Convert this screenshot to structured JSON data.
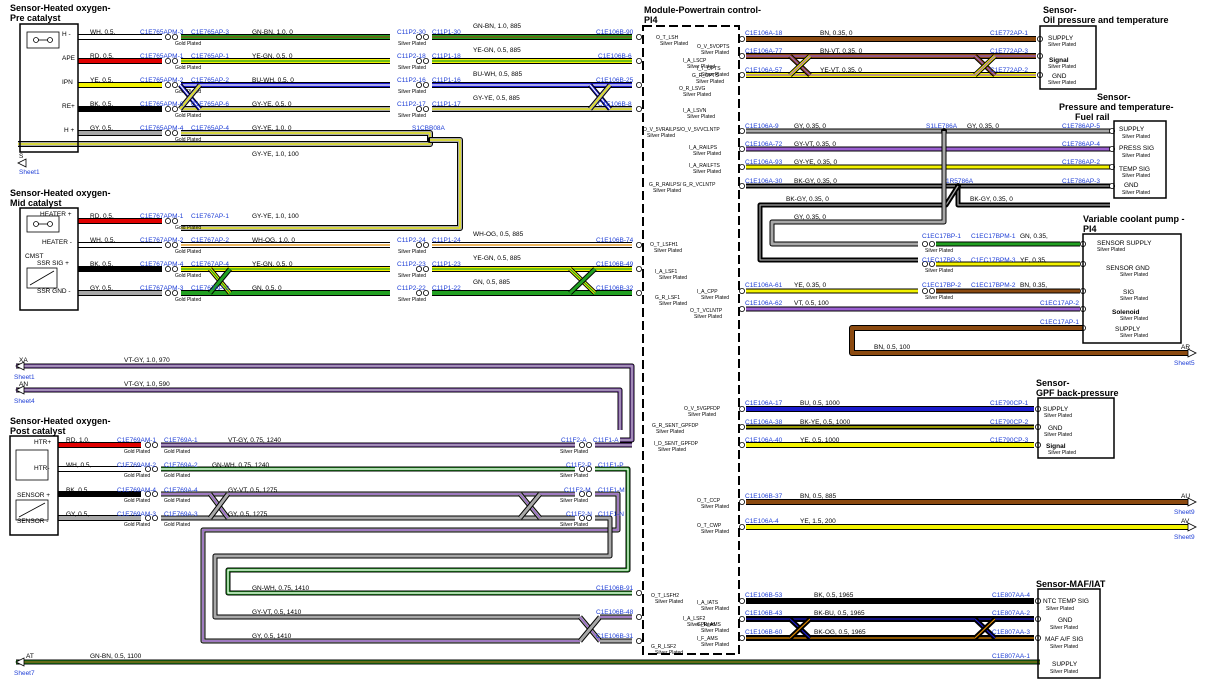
{
  "components": {
    "ho2_pre": {
      "title1": "Sensor-Heated oxygen-",
      "title2": "Pre catalyst",
      "pins": [
        "H -",
        "APE",
        "IPN",
        "RE+",
        "H +"
      ]
    },
    "ho2_mid": {
      "title1": "Sensor-Heated oxygen-",
      "title2": "Mid catalyst",
      "pins": [
        "HEATER +",
        "HEATER -",
        "SSR SIG +",
        "SSR GND -"
      ],
      "cmst": "CMST"
    },
    "ho2_post": {
      "title1": "Sensor-Heated oxygen-",
      "title2": "Post catalyst",
      "pins": [
        "HTR+",
        "HTR-",
        "SENSOR +",
        "SENSOR -"
      ]
    },
    "pcm": {
      "title1": "Module-Powertrain control-",
      "title2": "PI4",
      "signals": [
        "O_T_LSH",
        "O_V_5VOPTS",
        "I_A_LSCP",
        "I_T_OPTS",
        "G_R_OPTS",
        "O_R_LSVG",
        "I_A_LSVN",
        "O_V_5VRAILPS/O_V_5VVCLNTP",
        "I_A_RAILPS",
        "I_A_RAILFTS",
        "G_R_RAILPS/ G_R_VCLNTP",
        "O_T_LSFH1",
        "I_A_LSF1",
        "I_A_CPP",
        "G_R_LSF1",
        "O_T_VCLNTP",
        "O_V_5VGPFDP",
        "G_R_SENT_GPFDP",
        "I_D_SENT_GPFDP",
        "O_T_CCP",
        "O_T_CWP",
        "O_T_LSFH2",
        "I_A_IATS",
        "I_A_LSF2",
        "G_R_AMS",
        "I_F_AMS",
        "G_R_LSF2"
      ]
    },
    "oil": {
      "title1": "Sensor-",
      "title2": "Oil pressure and temperature",
      "pins": [
        "SUPPLY",
        "Signal",
        "GND"
      ]
    },
    "rail": {
      "title1": "Sensor-",
      "title2": "Pressure and temperature-",
      "title3": "Fuel rail",
      "pins": [
        "SUPPLY",
        "PRESS SIG",
        "TEMP SIG",
        "GND"
      ]
    },
    "coolant": {
      "title1": "Variable coolant pump -",
      "title2": "PI4",
      "pins": [
        "SENSOR SUPPLY",
        "SENSOR GND",
        "SIG",
        "Solenoid",
        "SUPPLY"
      ]
    },
    "gpf": {
      "title1": "Sensor-",
      "title2": "GPF back-pressure",
      "pins": [
        "SUPPLY",
        "GND",
        "Signal"
      ]
    },
    "maf": {
      "title1": "Sensor-MAF/IAT",
      "pins": [
        "NTC TEMP SIG",
        "GND",
        "MAF A/F SIG",
        "SUPPLY"
      ]
    }
  },
  "plating": {
    "gold": "Gold Plated",
    "silver": "Silver Plated"
  },
  "wires": [
    {
      "spec": "WH, 0.5,",
      "c1": "C1E765APM-3",
      "c2": "C1E765AP-3"
    },
    {
      "spec": "GN-BN, 1.0, 0",
      "c1": "C11P2-30",
      "c2": "C11P1-30"
    },
    {
      "spec": "GN-BN, 1.0, 885",
      "c1": "C1E106B-90",
      "c2": ""
    },
    {
      "spec": "RD, 0.5,",
      "c1": "C1E765APM-1",
      "c2": "C1E765AP-1"
    },
    {
      "spec": "YE-GN, 0.5, 0",
      "c1": "C11P2-18",
      "c2": "C11P1-18"
    },
    {
      "spec": "YE-GN, 0.5, 885",
      "c1": "C1E106B-6",
      "c2": ""
    },
    {
      "spec": "YE, 0.5,",
      "c1": "C1E765APM-2",
      "c2": "C1E765AP-2"
    },
    {
      "spec": "BU-WH, 0.5, 0",
      "c1": "C11P2-16",
      "c2": "C11P1-16"
    },
    {
      "spec": "BU-WH, 0.5, 885",
      "c1": "C1E106B-25",
      "c2": ""
    },
    {
      "spec": "BK, 0.5,",
      "c1": "C1E765APM-6",
      "c2": "C1E765AP-6"
    },
    {
      "spec": "GY-YE, 0.5, 0",
      "c1": "C11P2-17",
      "c2": "C11P1-17"
    },
    {
      "spec": "GY-YE, 0.5, 885",
      "c1": "C1E106B-8",
      "c2": ""
    },
    {
      "spec": "GY, 0.5,",
      "c1": "C1E765APM-4",
      "c2": "C1E765AP-4"
    },
    {
      "spec": "GY-YE, 1.0, 0",
      "c1": "S1CBB08A",
      "c2": ""
    },
    {
      "spec": "GY-YE, 1.0, 100",
      "c1": "",
      "c2": ""
    },
    {
      "spec": "RD, 0.5,",
      "c1": "C1E767APM-1",
      "c2": "C1E767AP-1"
    },
    {
      "spec": "GY-YE, 1.0, 100",
      "c1": "",
      "c2": ""
    },
    {
      "spec": "WH, 0.5,",
      "c1": "C1E767APM-2",
      "c2": "C1E767AP-2"
    },
    {
      "spec": "WH-OG, 1.0, 0",
      "c1": "C11P2-24",
      "c2": "C11P1-24"
    },
    {
      "spec": "WH-OG, 0.5, 885",
      "c1": "C1E106B-74",
      "c2": ""
    },
    {
      "spec": "BK, 0.5,",
      "c1": "C1E767APM-4",
      "c2": "C1E767AP-4"
    },
    {
      "spec": "YE-GN, 0.5, 0",
      "c1": "C11P2-23",
      "c2": "C11P1-23"
    },
    {
      "spec": "YE-GN, 0.5, 885",
      "c1": "C1E106B-49",
      "c2": ""
    },
    {
      "spec": "GY, 0.5,",
      "c1": "C1E767APM-3",
      "c2": "C1E767AP-3"
    },
    {
      "spec": "GN, 0.5, 0",
      "c1": "C11P2-22",
      "c2": "C11P1-22"
    },
    {
      "spec": "GN, 0.5, 885",
      "c1": "C1E106B-32",
      "c2": ""
    }
  ],
  "right_wires": [
    {
      "c1": "C1E106A-18",
      "spec": "BN, 0.35, 0",
      "c2": "C1E772AP-1"
    },
    {
      "c1": "C1E106A-77",
      "spec": "BN-VT, 0.35, 0",
      "c2": "C1E772AP-3"
    },
    {
      "c1": "C1E106A-57",
      "spec": "YE-VT, 0.35, 0",
      "c2": "C1E772AP-2"
    },
    {
      "c1": "C1E106A-9",
      "spec": "GY, 0.35, 0",
      "c2": "S1LE786A",
      "spec2": "GY, 0.35, 0",
      "c3": "C1E786AP-5"
    },
    {
      "c1": "C1E106A-72",
      "spec": "GY-VT, 0.35, 0",
      "c2": "C1E786AP-4"
    },
    {
      "c1": "C1E106A-93",
      "spec": "GY-YE, 0.35, 0",
      "c2": "C1E786AP-2"
    },
    {
      "c1": "C1E106A-30",
      "spec": "BK-GY, 0.35, 0",
      "c2": "1R5786A",
      "c3": "C1E786AP-3"
    },
    {
      "spec": "BK-GY, 0.35, 0"
    },
    {
      "spec": "BK-GY, 0.35, 0"
    },
    {
      "spec": "GY, 0.35, 0"
    },
    {
      "c1": "C1EC17BP-1",
      "c2": "C1EC17BPM-1",
      "spec": "GN, 0.35,"
    },
    {
      "c1": "C1EC17BP-3",
      "c2": "C1EC17BPM-3",
      "spec": "YE, 0.35,"
    },
    {
      "c1": "C1E106A-61",
      "spec": "YE, 0.35, 0",
      "c2": "C1EC17BP-2",
      "c3": "C1EC17BPM-2",
      "spec2": "BN, 0.35,"
    },
    {
      "c1": "C1E106A-62",
      "spec": "VT, 0.5, 100",
      "c2": "C1EC17AP-2"
    },
    {
      "c2": "C1EC17AP-1"
    },
    {
      "spec": "BN, 0.5, 100",
      "dest": "AR",
      "sheet": "Sheet5"
    },
    {
      "c1": "C1E106A-17",
      "spec": "BU, 0.5, 1000",
      "c2": "C1E790CP-1"
    },
    {
      "c1": "C1E106A-38",
      "spec": "BK-YE, 0.5, 1000",
      "c2": "C1E790CP-2"
    },
    {
      "c1": "C1E106A-40",
      "spec": "YE, 0.5, 1000",
      "c2": "C1E790CP-3"
    },
    {
      "c1": "C1E106B-37",
      "spec": "BN, 0.5, 885",
      "dest": "AU",
      "sheet": "Sheet9"
    },
    {
      "c1": "C1E106A-4",
      "spec": "YE, 1.5, 200",
      "dest": "AV",
      "sheet": "Sheet9"
    },
    {
      "c1": "C1E106B-53",
      "spec": "BK, 0.5, 1965",
      "c2": "C1E807AA-4"
    },
    {
      "c1": "C1E106B-43",
      "spec": "BK-BU, 0.5, 1965",
      "c2": "C1E807AA-2"
    },
    {
      "c1": "C1E106B-60",
      "spec": "BK-OG, 0.5, 1965",
      "c2": "C1E807AA-3"
    },
    {
      "c2": "C1E807AA-1"
    }
  ],
  "post_wires": [
    {
      "spec": "RD, 1.0,",
      "c1": "C1E769AM-1",
      "c2": "C1E769A-1",
      "spec2": "VT-GY, 0.75, 1240",
      "c3": "C11F2-A",
      "c4": "C11F1-A"
    },
    {
      "spec": "WH, 0.5,",
      "c1": "C1E769AM-2",
      "c2": "C1E769A-2",
      "spec2": "GN-WH, 0.75, 1240",
      "c3": "C11F2-P",
      "c4": "C11F1-P"
    },
    {
      "spec": "BK, 0.5,",
      "c1": "C1E769AM-4",
      "c2": "C1E769A-4",
      "spec2": "GY-VT, 0.5, 1275",
      "c3": "C11F2-M",
      "c4": "C11F1-M"
    },
    {
      "spec": "GY, 0.5,",
      "c1": "C1E769AM-3",
      "c2": "C1E769A-3",
      "spec2": "GY, 0.5, 1275",
      "c3": "C11F2-N",
      "c4": "C11F1-N"
    },
    {
      "spec": "GN-WH, 0.75, 1410",
      "c1": "C1E106B-91"
    },
    {
      "spec": "GY-VT, 0.5, 1410",
      "c1": "C1E106B-48"
    },
    {
      "spec": "GY, 0.5, 1410",
      "c1": "C1E106B-31"
    }
  ],
  "offpage": [
    {
      "label": "S",
      "sheet": "Sheet1"
    },
    {
      "label": "XA",
      "spec": "VT-GY, 1.0, 970",
      "sheet": "Sheet1"
    },
    {
      "label": "AN",
      "spec": "VT-GY, 1.0, 590",
      "sheet": "Sheet4"
    },
    {
      "label": "AT",
      "spec": "GN-BN, 0.5, 1100",
      "sheet": "Sheet7",
      "c1": "C1E807AA-1"
    }
  ]
}
